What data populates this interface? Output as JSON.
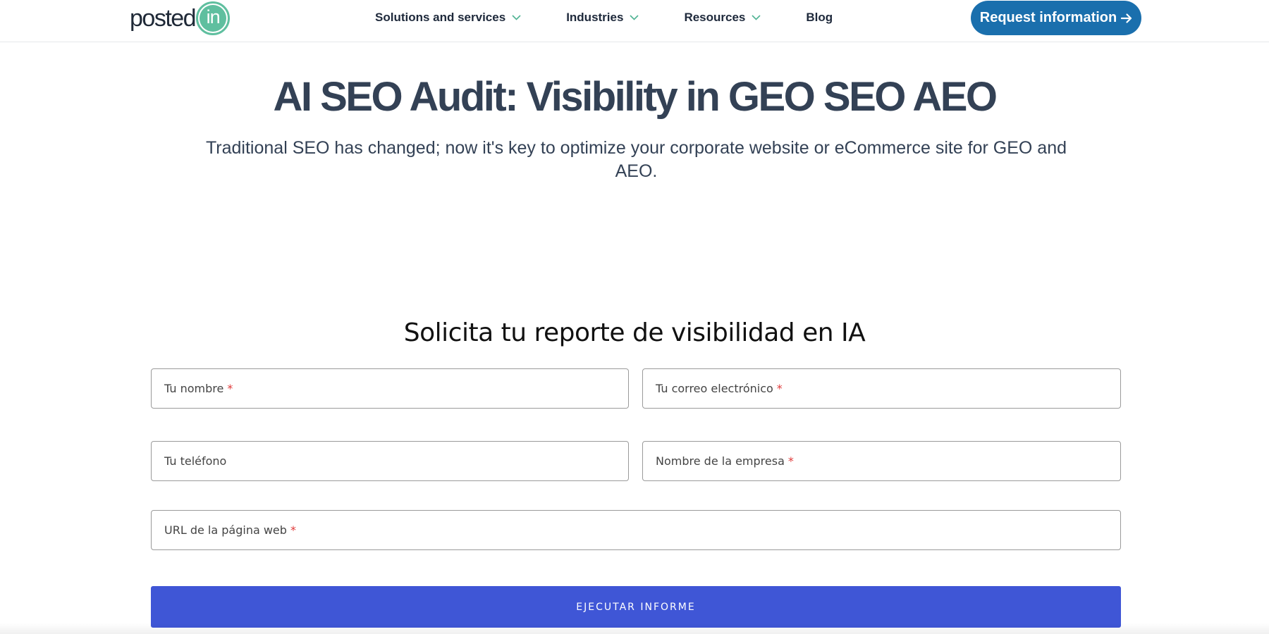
{
  "header": {
    "logo": {
      "text": "posted",
      "badge": "in"
    },
    "nav": [
      {
        "label": "Solutions and services",
        "icon": "chevron-down-icon"
      },
      {
        "label": "Industries",
        "icon": "chevron-down-icon"
      },
      {
        "label": "Resources",
        "icon": "chevron-down-icon"
      },
      {
        "label": "Blog"
      }
    ],
    "cta_label": "Request information",
    "cta_icon": "arrow-right-icon"
  },
  "hero": {
    "title": "AI SEO Audit: Visibility in GEO SEO AEO",
    "subtitle": "Traditional SEO has changed; now it's key to optimize your corporate website or eCommerce site for GEO and AEO."
  },
  "form": {
    "title": "Solicita tu reporte de visibilidad en IA",
    "fields": {
      "name": {
        "placeholder": "Tu nombre",
        "required": "*"
      },
      "email": {
        "placeholder": "Tu correo electrónico",
        "required": "*"
      },
      "phone": {
        "placeholder": "Tu teléfono"
      },
      "company": {
        "placeholder": "Nombre de la empresa",
        "required": "*"
      },
      "url": {
        "placeholder": "URL de la página web",
        "required": "*"
      }
    },
    "submit_label": "EJECUTAR INFORME"
  },
  "colors": {
    "brand_teal": "#5fbf9f",
    "cta_blue": "#1a6fad",
    "submit_blue": "#3f56d6",
    "required_red": "#e03a3a",
    "text_dark": "#334155"
  }
}
